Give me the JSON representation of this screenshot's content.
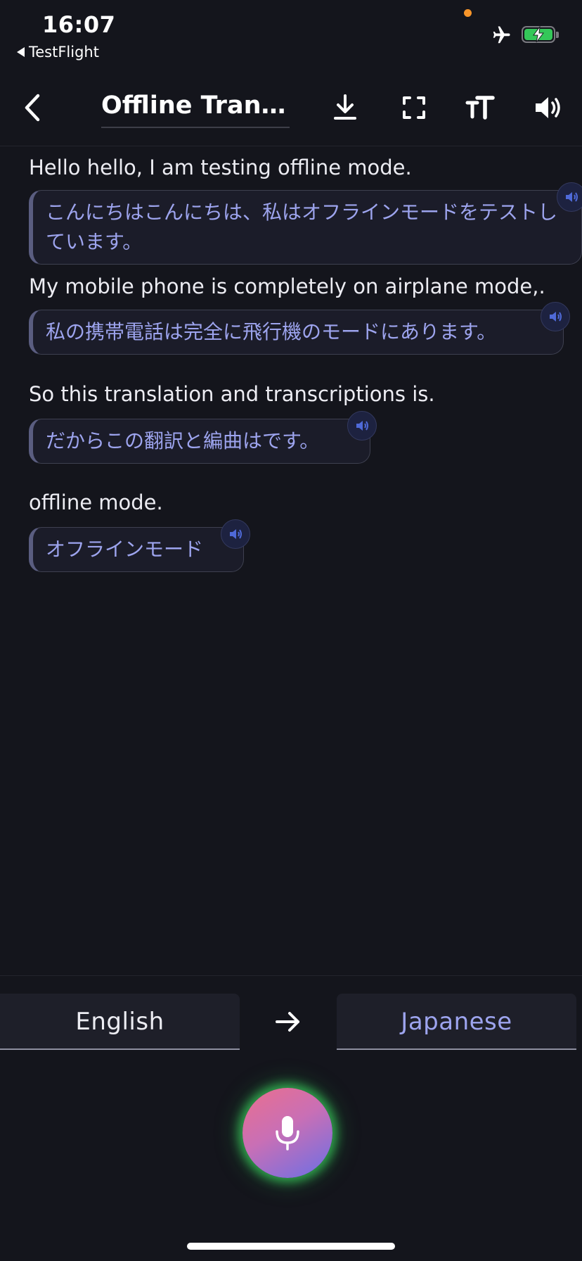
{
  "status_bar": {
    "time": "16:07",
    "back_app": "TestFlight",
    "icons": [
      "airplane-icon",
      "battery-charging-icon"
    ]
  },
  "nav": {
    "title": "Offline Translation",
    "icons": [
      "chevron-left-icon",
      "download-icon",
      "fullscreen-icon",
      "text-size-icon",
      "speaker-icon"
    ]
  },
  "conversation": [
    {
      "source": "Hello hello, I am testing offline mode.",
      "translation": "こんにちはこんにちは、私はオフラインモードをテストしています。"
    },
    {
      "source": "My mobile phone is completely on airplane mode,.",
      "translation": "私の携帯電話は完全に飛行機のモードにあります。"
    },
    {
      "source": "So this translation and transcriptions is.",
      "translation": "だからこの翻訳と編曲はです。"
    },
    {
      "source": "offline mode.",
      "translation": "オフラインモード"
    }
  ],
  "languages": {
    "source": "English",
    "target": "Japanese"
  },
  "colors": {
    "background": "#14151c",
    "translation_text": "#9da4ee",
    "mic_glow": "#38c85a"
  }
}
